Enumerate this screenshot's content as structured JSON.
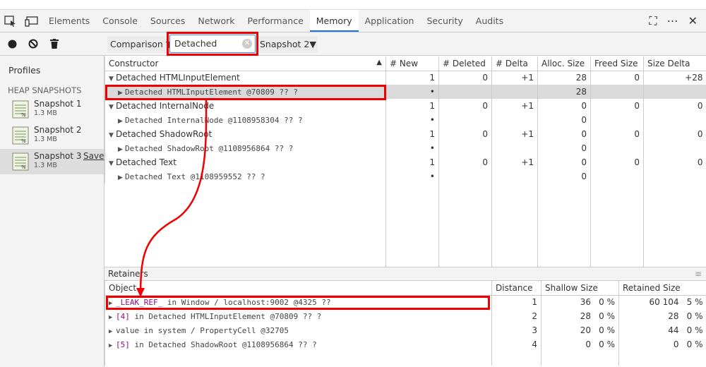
{
  "tabs": [
    "Elements",
    "Console",
    "Sources",
    "Network",
    "Performance",
    "Memory",
    "Application",
    "Security",
    "Audits"
  ],
  "active_tab": "Memory",
  "toolbar": {
    "view": "Comparison",
    "filter_value": "Detached",
    "baseline": "Snapshot 2"
  },
  "sidebar": {
    "title": "Profiles",
    "section": "HEAP SNAPSHOTS",
    "snapshots": [
      {
        "name": "Snapshot 1",
        "size": "1.3 MB"
      },
      {
        "name": "Snapshot 2",
        "size": "1.3 MB"
      },
      {
        "name": "Snapshot 3",
        "size": "1.3 MB",
        "action": "Save"
      }
    ]
  },
  "comparison": {
    "headers": [
      "Constructor",
      "# New",
      "# Deleted",
      "# Delta",
      "Alloc. Size",
      "Freed Size",
      "Size Delta"
    ],
    "rows": [
      {
        "name": "Detached HTMLInputElement",
        "new": "1",
        "deleted": "0",
        "delta": "+1",
        "alloc": "28",
        "freed": "0",
        "sdelta": "+28"
      },
      {
        "name": "Detached HTMLInputElement @70809 ?? ?",
        "new": "•",
        "deleted": "",
        "delta": "",
        "alloc": "28",
        "freed": "",
        "sdelta": ""
      },
      {
        "name": "Detached InternalNode",
        "new": "1",
        "deleted": "0",
        "delta": "+1",
        "alloc": "0",
        "freed": "0",
        "sdelta": "0"
      },
      {
        "name": "Detached InternalNode @1108958304 ?? ?",
        "new": "•",
        "deleted": "",
        "delta": "",
        "alloc": "0",
        "freed": "",
        "sdelta": ""
      },
      {
        "name": "Detached ShadowRoot",
        "new": "1",
        "deleted": "0",
        "delta": "+1",
        "alloc": "0",
        "freed": "0",
        "sdelta": "0"
      },
      {
        "name": "Detached ShadowRoot @1108956864 ?? ?",
        "new": "•",
        "deleted": "",
        "delta": "",
        "alloc": "0",
        "freed": "",
        "sdelta": ""
      },
      {
        "name": "Detached Text",
        "new": "1",
        "deleted": "0",
        "delta": "+1",
        "alloc": "0",
        "freed": "0",
        "sdelta": "0"
      },
      {
        "name": "Detached Text @1108959552 ?? ?",
        "new": "•",
        "deleted": "",
        "delta": "",
        "alloc": "0",
        "freed": "",
        "sdelta": ""
      }
    ]
  },
  "retainers": {
    "title": "Retainers",
    "headers": [
      "Object",
      "Distance",
      "Shallow Size",
      "Retained Size"
    ],
    "rows": [
      {
        "prop": "_LEAK_REF_",
        "rest": " in Window / localhost:9002 @4325 ??",
        "distance": "1",
        "shallow": "36",
        "shallow_pct": "0 %",
        "retained": "60 104",
        "retained_pct": "5 %"
      },
      {
        "prop": "[4]",
        "rest": " in Detached HTMLInputElement @70809 ?? ?",
        "distance": "2",
        "shallow": "28",
        "shallow_pct": "0 %",
        "retained": "28",
        "retained_pct": "0 %"
      },
      {
        "prop": "",
        "rest": "value in system / PropertyCell @32705",
        "distance": "3",
        "shallow": "20",
        "shallow_pct": "0 %",
        "retained": "44",
        "retained_pct": "0 %"
      },
      {
        "prop": "[5]",
        "rest": " in Detached ShadowRoot @1108956864 ?? ?",
        "distance": "4",
        "shallow": "0",
        "shallow_pct": "0 %",
        "retained": "0",
        "retained_pct": "0 %"
      }
    ]
  },
  "highlight_color": "#e00000"
}
